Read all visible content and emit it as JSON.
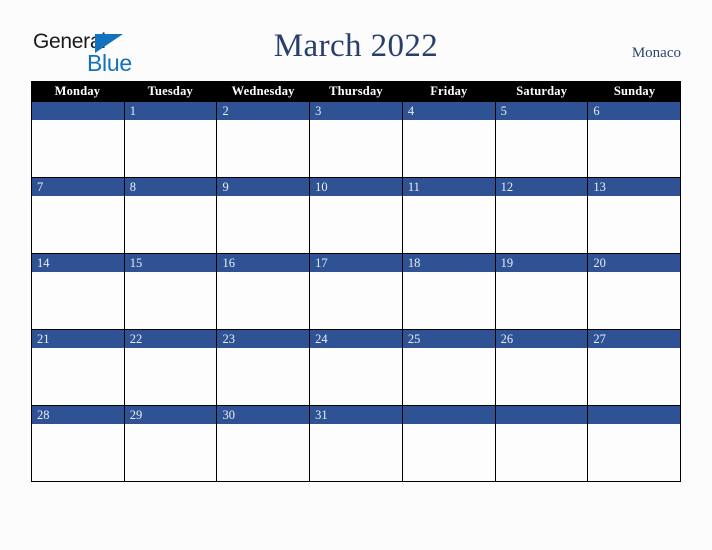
{
  "brand": {
    "name_part1": "General",
    "name_part2": "Blue",
    "triangle_color": "#1272bd",
    "text_color": "#1b1b1b"
  },
  "header": {
    "title": "March 2022",
    "locale": "Monaco",
    "title_color": "#27406b"
  },
  "calendar": {
    "month": "March",
    "year": "2022",
    "weekday_headers": [
      "Monday",
      "Tuesday",
      "Wednesday",
      "Thursday",
      "Friday",
      "Saturday",
      "Sunday"
    ],
    "header_bg": "#000000",
    "header_text_color": "#ffffff",
    "date_strip_color": "#2e5293",
    "date_text_color": "#e9edf5",
    "cell_bg": "#fdfdfd",
    "border_color": "#000000",
    "weeks": [
      [
        "",
        "1",
        "2",
        "3",
        "4",
        "5",
        "6"
      ],
      [
        "7",
        "8",
        "9",
        "10",
        "11",
        "12",
        "13"
      ],
      [
        "14",
        "15",
        "16",
        "17",
        "18",
        "19",
        "20"
      ],
      [
        "21",
        "22",
        "23",
        "24",
        "25",
        "26",
        "27"
      ],
      [
        "28",
        "29",
        "30",
        "31",
        "",
        "",
        ""
      ]
    ]
  },
  "page": {
    "background": "#fdfcfc"
  }
}
